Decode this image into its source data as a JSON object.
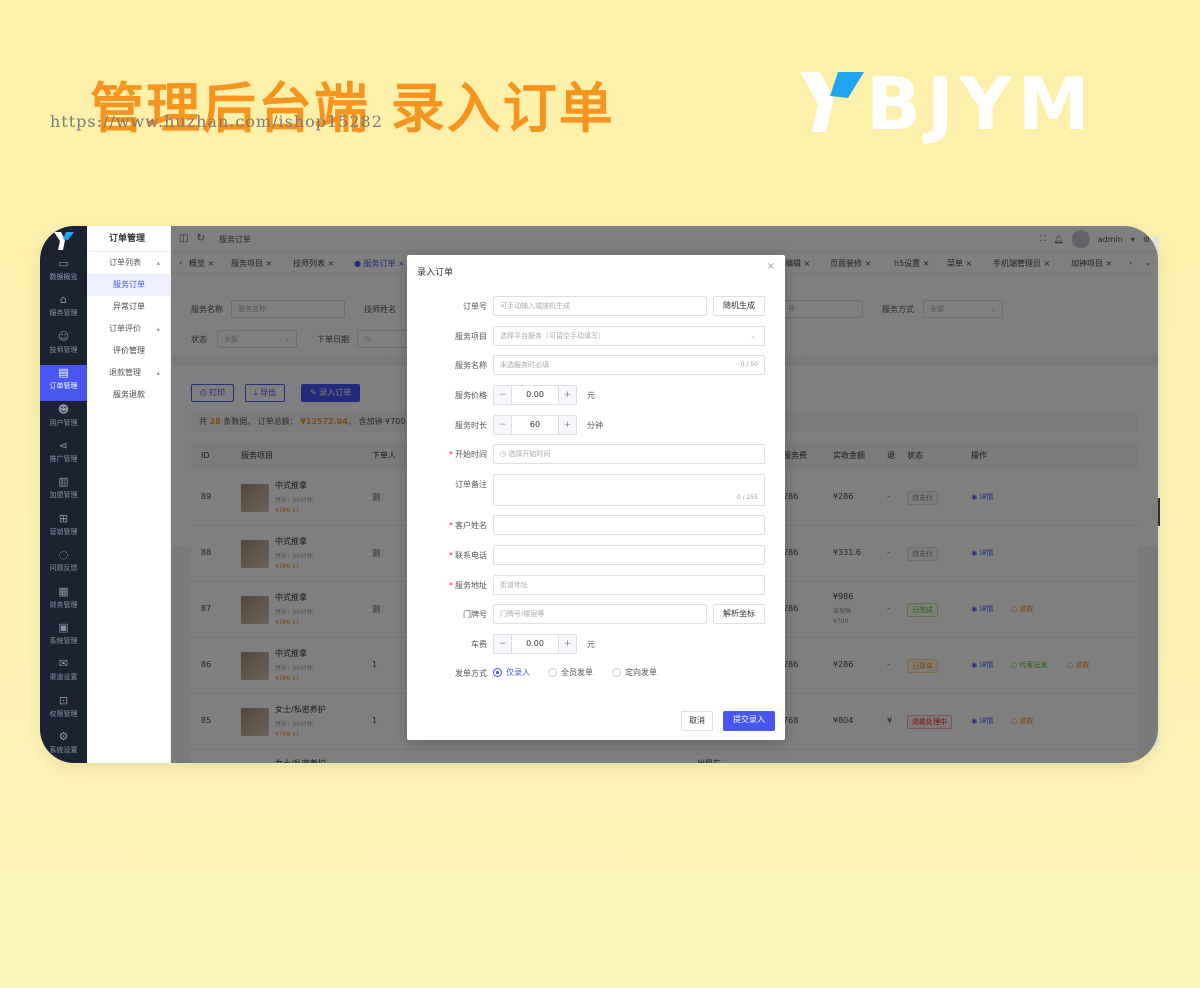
{
  "banner": {
    "title": "管理后台端 录入订单",
    "watermark": "https://www.huzhan.com/ishop15282",
    "logo_text": "BJYM"
  },
  "sidebar": {
    "items": [
      {
        "label": "数据概览",
        "icon": "monitor-icon"
      },
      {
        "label": "服务管理",
        "icon": "bag-icon"
      },
      {
        "label": "技师管理",
        "icon": "user-icon"
      },
      {
        "label": "订单管理",
        "icon": "order-icon",
        "active": true
      },
      {
        "label": "用户管理",
        "icon": "users-icon"
      },
      {
        "label": "推广管理",
        "icon": "share-icon"
      },
      {
        "label": "加盟管理",
        "icon": "building-icon"
      },
      {
        "label": "营销管理",
        "icon": "gift-icon"
      },
      {
        "label": "问题反馈",
        "icon": "chat-icon"
      },
      {
        "label": "财务管理",
        "icon": "finance-icon"
      },
      {
        "label": "系统管理",
        "icon": "box-icon"
      },
      {
        "label": "渠道设置",
        "icon": "mail-icon"
      },
      {
        "label": "权限管理",
        "icon": "lock-icon"
      },
      {
        "label": "系统设置",
        "icon": "gear-icon"
      }
    ]
  },
  "submenu": {
    "title": "订单管理",
    "groups": [
      {
        "label": "订单列表",
        "items": [
          "服务订单",
          "异常订单"
        ]
      },
      {
        "label": "订单评价",
        "items": [
          "评价管理"
        ]
      },
      {
        "label": "退款管理",
        "items": [
          "服务退款"
        ]
      }
    ]
  },
  "topbar": {
    "crumb": "服务订单",
    "user": "admin"
  },
  "tabs": [
    "概览",
    "服务项目",
    "技师列表",
    "服务订单",
    "编辑",
    "页面装修",
    "h5设置",
    "菜单",
    "手机端管理员",
    "加钟项目"
  ],
  "filter": {
    "service_name_label": "服务名称",
    "service_name_ph": "服务名称",
    "tech_name_label": "技师姓名",
    "number_ph": "号",
    "service_mode_label": "服务方式",
    "service_mode_val": "全部",
    "status_label": "状态",
    "status_val": "全部",
    "order_date_label": "下单日期"
  },
  "toolbar": {
    "print": "打印",
    "export": "导出",
    "add": "录入订单"
  },
  "summary": {
    "prefix": "共",
    "count": "28",
    "mid": "条数据， 订单总额：",
    "total": "¥12572.04",
    "suffix": "， 含加钟 ¥700，"
  },
  "table": {
    "headers": {
      "id": "ID",
      "service": "服务项目",
      "user": "下单人",
      "fee": "服务费",
      "paid": "实收金额",
      "refund": "退",
      "status": "状态",
      "ops": "操作"
    },
    "rows": [
      {
        "id": "89",
        "name": "中式推拿",
        "dur": "时长：60分钟",
        "price": "¥286 x1",
        "user": "测",
        "fee": "286",
        "paid": "¥286",
        "refund": "-",
        "status": "待支付",
        "status_cls": "",
        "ops": [
          "详情"
        ]
      },
      {
        "id": "88",
        "name": "中式推拿",
        "dur": "时长：60分钟",
        "price": "¥286 x1",
        "user": "测",
        "fee": "286",
        "paid": "¥331.6",
        "refund": "-",
        "status": "待支付",
        "status_cls": "",
        "ops": [
          "详情"
        ]
      },
      {
        "id": "87",
        "name": "中式推拿",
        "dur": "时长：60分钟",
        "price": "¥286 x1",
        "user": "测",
        "fee": "286",
        "paid": "¥986",
        "paid2": "含加钟",
        "paid3": "¥700",
        "refund": "-",
        "status": "已完成",
        "status_cls": "green",
        "ops": [
          "详情",
          "退款"
        ]
      },
      {
        "id": "86",
        "name": "中式推拿",
        "dur": "时长：60分钟",
        "price": "¥286 x1",
        "user": "1",
        "fee": "286",
        "paid": "¥286",
        "refund": "-",
        "status": "已接单",
        "status_cls": "orange",
        "ops": [
          "详情",
          "代客出发",
          "退款"
        ]
      },
      {
        "id": "85",
        "name": "女士/私密养护",
        "dur": "时长：60分钟",
        "price": "¥768 x1",
        "user": "1",
        "fee": "768",
        "paid": "¥804",
        "refund": "¥",
        "status": "退款处理中",
        "status_cls": "red",
        "ops": [
          "详情",
          "退款"
        ]
      }
    ],
    "partial_row": {
      "name": "女士/私密养护",
      "extra": "出租车"
    }
  },
  "modal": {
    "title": "录入订单",
    "order_no_label": "订单号",
    "order_no_ph": "可手动输入或随机生成",
    "random_btn": "随机生成",
    "item_label": "服务项目",
    "item_ph": "选择平台服务（可留空手动填写）",
    "name_label": "服务名称",
    "name_ph": "未选服务时必填",
    "name_count": "0 / 50",
    "price_label": "服务价格",
    "price_val": "0.00",
    "price_unit": "元",
    "dur_label": "服务时长",
    "dur_val": "60",
    "dur_unit": "分钟",
    "start_label": "开始时间",
    "start_ph": "选择开始时间",
    "remark_label": "订单备注",
    "remark_count": "0 / 255",
    "cust_label": "客户姓名",
    "phone_label": "联系电话",
    "addr_label": "服务地址",
    "addr_ph": "街道地址",
    "door_label": "门牌号",
    "door_ph": "门牌号/楼层等",
    "parse_btn": "解析坐标",
    "car_label": "车费",
    "car_val": "0.00",
    "car_unit": "元",
    "dispatch_label": "发单方式",
    "dispatch_opts": [
      "仅录入",
      "全员发单",
      "定向发单"
    ],
    "dispatch_selected": "仅录入",
    "cancel": "取消",
    "submit": "提交录入"
  },
  "colors": {
    "accent": "#4658f0",
    "banner": "#f7941d",
    "sidebar": "#1d2232"
  }
}
